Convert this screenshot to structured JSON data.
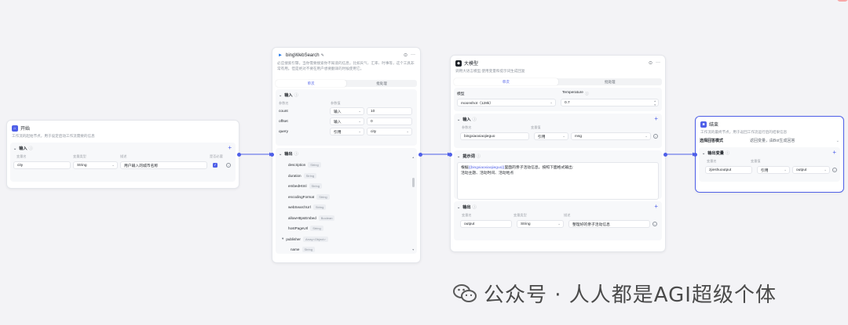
{
  "start": {
    "title": "开始",
    "desc": "工作流的起始节点，用于设定启动工作流需要的信息",
    "input_title": "输入",
    "cols": [
      "变量名",
      "变量类型",
      "描述",
      "是否必要"
    ],
    "var_name": "city",
    "var_type": "String",
    "var_desc": "用户输入的城市名称"
  },
  "bing": {
    "title": "bingWebSearch",
    "desc": "必应搜索引擎。当你需要搜索你不知道的信息，比如天气、汇率、时事等，这个工具非常有用。但是绝对不要在用户想要翻译的时候使用它。",
    "tabs": [
      "单次",
      "批处理"
    ],
    "input_title": "输入",
    "cols": [
      "参数名",
      "参数值"
    ],
    "params": [
      {
        "name": "count",
        "mode": "输入",
        "value": "10"
      },
      {
        "name": "offset",
        "mode": "输入",
        "value": "0"
      },
      {
        "name": "query",
        "mode": "引用",
        "value": "city"
      }
    ],
    "output_title": "输出",
    "outputs": [
      {
        "name": "description",
        "type": "String"
      },
      {
        "name": "duration",
        "type": "String"
      },
      {
        "name": "embedHtml",
        "type": "String"
      },
      {
        "name": "encodingFormat",
        "type": "String"
      },
      {
        "name": "webSearchUrl",
        "type": "String"
      },
      {
        "name": "allowHttpsEmbed",
        "type": "Boolean"
      },
      {
        "name": "hostPageUrl",
        "type": "String"
      },
      {
        "name": "publisher",
        "type": "Array<Object>"
      },
      {
        "name": "name",
        "type": "String"
      }
    ]
  },
  "llm": {
    "title": "大模型",
    "desc": "调用大语言模型,使用变量和提示词生成回复",
    "tabs": [
      "单次",
      "批处理"
    ],
    "model_label": "模型",
    "model_value": "moonshot（128k）",
    "temp_label": "Temperature",
    "temp_value": "0.7",
    "input_title": "输入",
    "input_cols": [
      "参数名",
      "变量值"
    ],
    "input_name": "bingxiaoxiaojieguo",
    "input_mode": "引用",
    "input_value": "msg",
    "prompt_title": "提示词",
    "prompt_pre": "根据",
    "prompt_var": "{{bingxiaoxiaojieguo}}",
    "prompt_post": "里面的亲子活动信息，按照下面格式输出:",
    "prompt_line2": "活动主题、活动时间、活动地点",
    "output_title": "输出",
    "output_cols": [
      "变量名",
      "变量类型",
      "描述"
    ],
    "output_name": "output",
    "output_type": "String",
    "output_desc": "整理好的亲子活动信息"
  },
  "end": {
    "title": "结束",
    "desc": "工作流的最终节点，用于返回工作流运行后的结果信息",
    "mode_label": "选择回答模式",
    "mode_value": "返回变量，由Bot生成回答",
    "output_title": "输出变量",
    "cols": [
      "变量名",
      "变量值"
    ],
    "var_name": "zjieshuoutput",
    "var_mode": "引用",
    "var_value": "output"
  },
  "watermark": "公众号 · 人人都是AGI超级个体",
  "colors": {
    "accent": "#4e5fe8",
    "start_icon": "#4e5fe8",
    "end_icon": "#4e5fe8",
    "bing_icon": "#1a73e8"
  }
}
